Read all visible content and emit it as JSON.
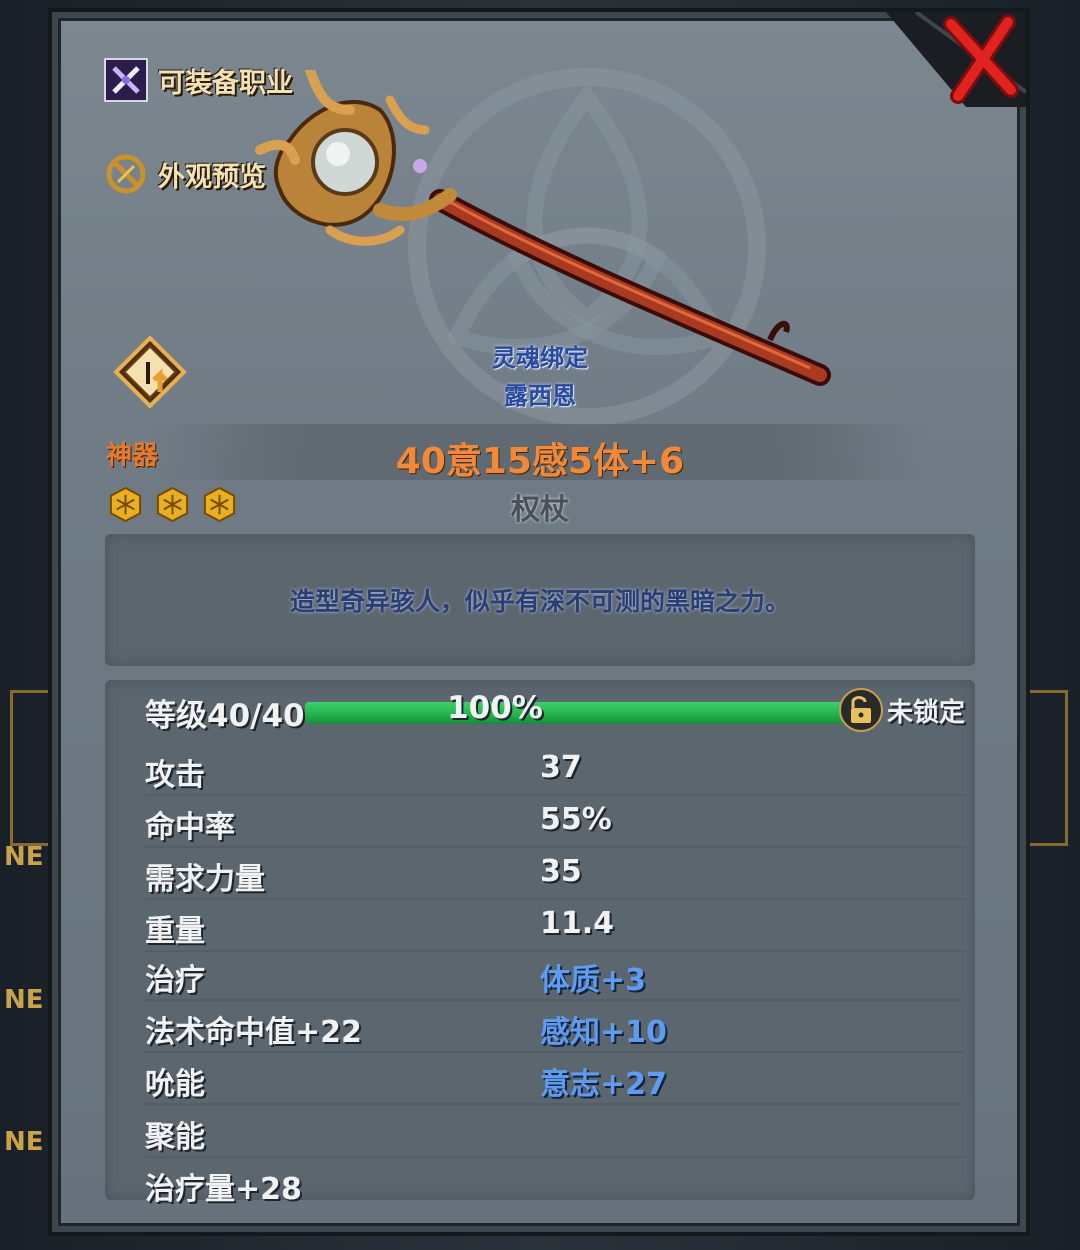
{
  "header": {
    "equip_class_label": "可装备职业",
    "appearance_preview_label": "外观预览",
    "close_icon": "close-icon"
  },
  "item": {
    "bind_status": "灵魂绑定",
    "owner": "露西恩",
    "rarity": "神器",
    "star_count": 3,
    "summary": "40意15感5体+6",
    "type": "权杖",
    "description": "造型奇异骇人，似乎有深不可测的黑暗之力。"
  },
  "level": {
    "label": "等级40/40",
    "progress_percent": 100,
    "progress_text": "100%",
    "lock_label": "未锁定"
  },
  "stats": [
    {
      "key": "攻击",
      "value": "37",
      "value_blue": false
    },
    {
      "key": "命中率",
      "value": "55%",
      "value_blue": false
    },
    {
      "key": "需求力量",
      "value": "35",
      "value_blue": false
    },
    {
      "key": "重量",
      "value": "11.4",
      "value_blue": false
    },
    {
      "key": "治疗",
      "value": "体质+3",
      "value_blue": true
    },
    {
      "key": "法术命中值+22",
      "value": "感知+10",
      "value_blue": true
    },
    {
      "key": "吮能",
      "value": "意志+27",
      "value_blue": true
    },
    {
      "key": "聚能",
      "value": "",
      "value_blue": false
    },
    {
      "key": "治疗量+28",
      "value": "",
      "value_blue": false
    }
  ],
  "side_tags": [
    "NE",
    "NE",
    "NE"
  ],
  "colors": {
    "rarity": "#e87a2a",
    "bind": "#2b4a9a",
    "progress": "#22b04b",
    "close": "#d81f1f",
    "blue_value": "#5f9cf0"
  }
}
